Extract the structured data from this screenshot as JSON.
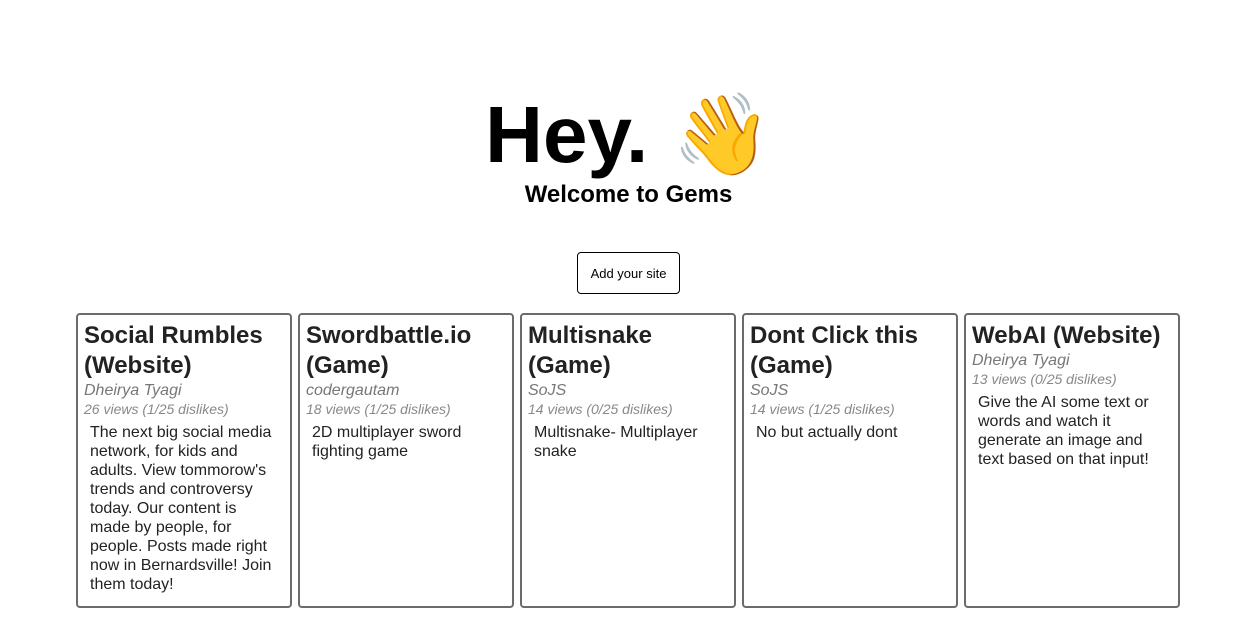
{
  "hero": {
    "title": "Hey.",
    "emoji": "👋"
  },
  "welcome": "Welcome to Gems",
  "add_button_label": "Add your site",
  "cards": [
    {
      "title": "Social Rumbles (Website)",
      "author": "Dheirya Tyagi",
      "stats": "26 views (1/25 dislikes)",
      "description": "The next big social media network, for kids and adults. View tommorow's trends and controversy today. Our content is made by people, for people. Posts made right now in Bernardsville! Join them today!"
    },
    {
      "title": "Swordbattle.io (Game)",
      "author": "codergautam",
      "stats": "18 views (1/25 dislikes)",
      "description": "2D multiplayer sword fighting game"
    },
    {
      "title": "Multisnake (Game)",
      "author": "SoJS",
      "stats": "14 views (0/25 dislikes)",
      "description": "Multisnake- Multiplayer snake"
    },
    {
      "title": "Dont Click this (Game)",
      "author": "SoJS",
      "stats": "14 views (1/25 dislikes)",
      "description": "No but actually dont"
    },
    {
      "title": "WebAI (Website)",
      "author": "Dheirya Tyagi",
      "stats": "13 views (0/25 dislikes)",
      "description": "Give the AI some text or words and watch it generate an image and text based on that input!"
    }
  ]
}
